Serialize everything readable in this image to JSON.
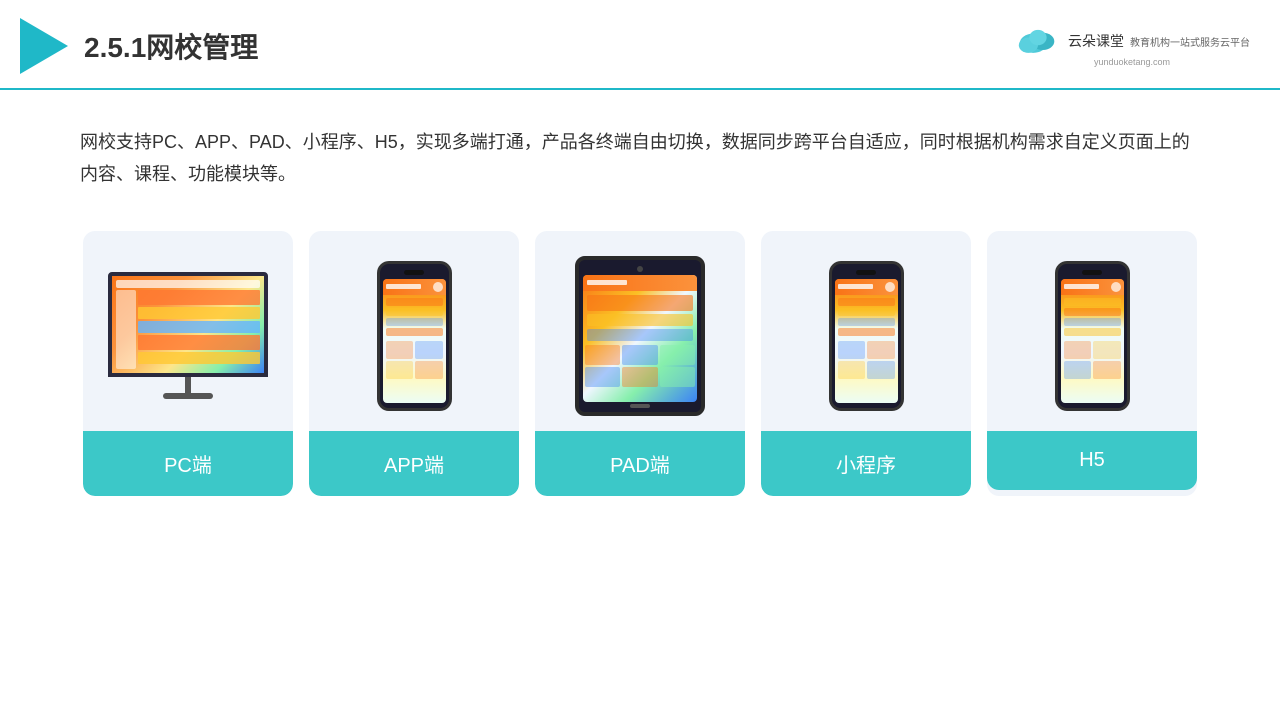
{
  "header": {
    "title": "2.5.1网校管理",
    "brand": {
      "name": "云朵课堂",
      "tagline": "教育机构一站式服务云平台",
      "url": "yunduoketang.com"
    }
  },
  "description": "网校支持PC、APP、PAD、小程序、H5，实现多端打通，产品各终端自由切换，数据同步跨平台自适应，同时根据机构需求自定义页面上的内容、课程、功能模块等。",
  "cards": [
    {
      "id": "pc",
      "label": "PC端"
    },
    {
      "id": "app",
      "label": "APP端"
    },
    {
      "id": "pad",
      "label": "PAD端"
    },
    {
      "id": "miniprogram",
      "label": "小程序"
    },
    {
      "id": "h5",
      "label": "H5"
    }
  ]
}
